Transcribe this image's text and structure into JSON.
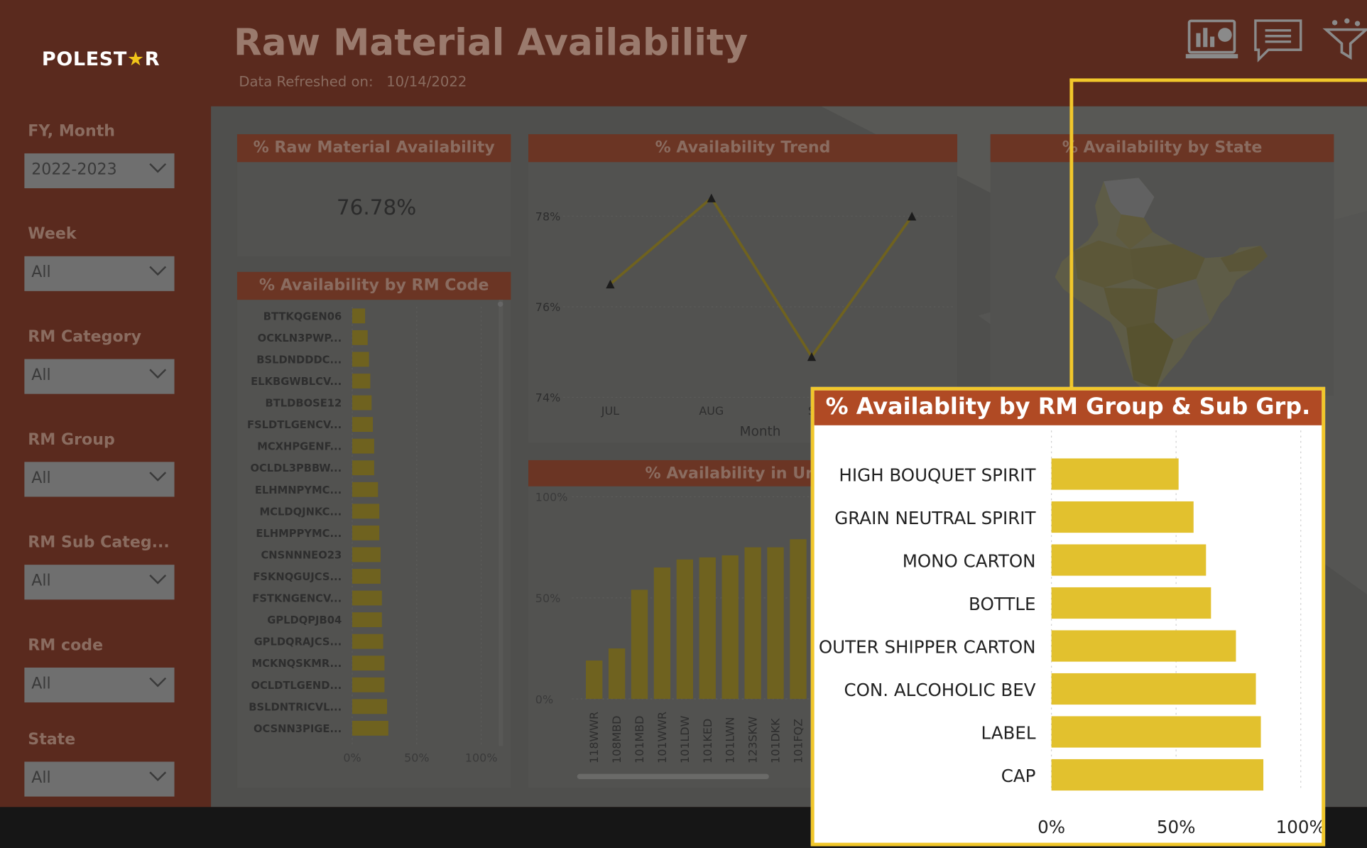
{
  "header": {
    "logo_left": "POLEST",
    "logo_star": "★",
    "logo_right": "R",
    "title": "Raw Material Availability",
    "refreshed_label": "Data Refreshed on:",
    "refreshed_value": "10/14/2022"
  },
  "header_icons": [
    "chart-report-icon",
    "comment-icon",
    "filter-icon"
  ],
  "filters": [
    {
      "label": "FY, Month",
      "value": "2022-2023"
    },
    {
      "label": "Week",
      "value": "All"
    },
    {
      "label": "RM Category",
      "value": "All"
    },
    {
      "label": "RM Group",
      "value": "All"
    },
    {
      "label": "RM Sub Categ...",
      "value": "All"
    },
    {
      "label": "RM code",
      "value": "All"
    },
    {
      "label": "State",
      "value": "All"
    }
  ],
  "kpi": {
    "title": "% Raw Material Availability",
    "value": "76.78%"
  },
  "rm_code_chart": {
    "title": "% Availability by RM Code",
    "codes": [
      "BTTKQGEN06",
      "OCKLN3PWP...",
      "BSLDNDDDC...",
      "ELKBGWBLCV...",
      "BTLDBOSE12",
      "FSLDTLGENCV...",
      "MCXHPGENF...",
      "OCLDL3PBBW...",
      "ELHMNPYMC...",
      "MCLDQJNKC...",
      "ELHMPPYMC...",
      "CNSNNNEO23",
      "FSKNQGUJCS...",
      "FSTKNGENCV...",
      "GPLDQPJB04",
      "GPLDQRAJCS...",
      "MCKNQSKMR...",
      "OCLDTLGEND...",
      "BSLDNTRICVL...",
      "OCSNN3PIGE..."
    ],
    "values": [
      10,
      12,
      13,
      14,
      15,
      16,
      17,
      17,
      20,
      21,
      21,
      22,
      22,
      23,
      23,
      24,
      25,
      25,
      27,
      28
    ],
    "ticks": [
      "0%",
      "50%",
      "100%"
    ]
  },
  "trend": {
    "title": "% Availability Trend",
    "months": [
      "JUL",
      "AUG",
      "S"
    ],
    "values": [
      76.5,
      78.4,
      74.9,
      78.0
    ],
    "y_ticks": [
      "78%",
      "76%",
      "74%"
    ],
    "xlabel": "Month"
  },
  "unit": {
    "title_visible": "% Availability in Unit C",
    "units": [
      "118WWR",
      "108MBD",
      "101MBD",
      "101WWR",
      "101LDW",
      "101KED",
      "101LWN",
      "123SKW",
      "101DKK",
      "101FQZ"
    ],
    "values": [
      19,
      25,
      54,
      65,
      69,
      70,
      71,
      75,
      75,
      79
    ],
    "y_ticks": [
      "100%",
      "50%",
      "0%"
    ]
  },
  "state": {
    "title": "% Availability by State"
  },
  "chart_data": {
    "type": "bar",
    "title": "% Availablity by RM Group & Sub Grp.",
    "orientation": "horizontal",
    "categories": [
      "HIGH BOUQUET SPIRIT",
      "GRAIN NEUTRAL SPIRIT",
      "MONO CARTON",
      "BOTTLE",
      "OUTER SHIPPER CARTON",
      "CON. ALCOHOLIC BEV",
      "LABEL",
      "CAP"
    ],
    "values": [
      51,
      57,
      62,
      64,
      74,
      82,
      84,
      85
    ],
    "xlim": [
      0,
      100
    ],
    "x_ticks": [
      "0%",
      "50%",
      "100%"
    ],
    "grid": true,
    "color": "#e2c12e"
  }
}
